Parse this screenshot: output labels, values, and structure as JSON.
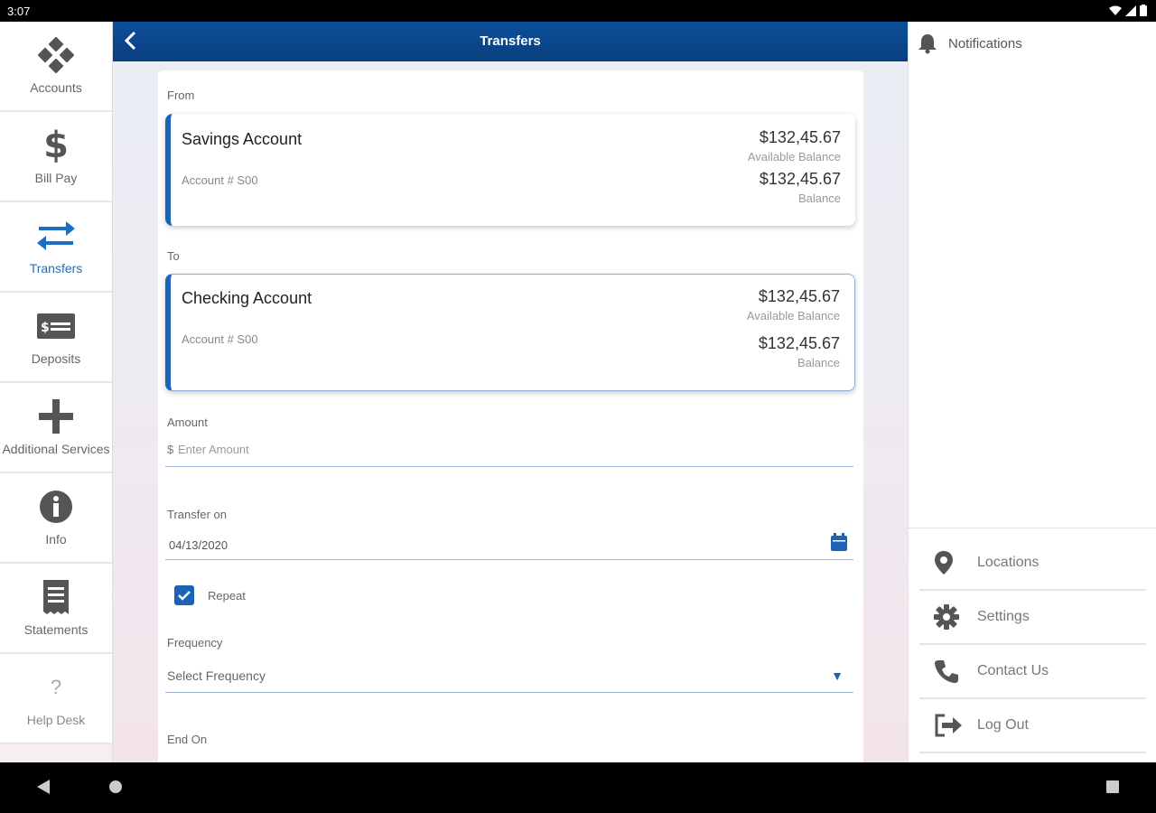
{
  "status_bar": {
    "time": "3:07"
  },
  "left_nav": {
    "items": [
      {
        "label": "Accounts"
      },
      {
        "label": "Bill Pay"
      },
      {
        "label": "Transfers"
      },
      {
        "label": "Deposits"
      },
      {
        "label": "Additional Services"
      },
      {
        "label": "Info"
      },
      {
        "label": "Statements"
      },
      {
        "label": "Help Desk"
      }
    ],
    "active": "Transfers"
  },
  "header": {
    "title": "Transfers"
  },
  "form": {
    "from_label": "From",
    "from_account": {
      "name": "Savings Account",
      "number": "Account # S00",
      "available_balance": "$132,45.67",
      "available_balance_label": "Available Balance",
      "balance": "$132,45.67",
      "balance_label": "Balance"
    },
    "to_label": "To",
    "to_account": {
      "name": "Checking Account",
      "number": "Account # S00",
      "available_balance": "$132,45.67",
      "available_balance_label": "Available Balance",
      "balance": "$132,45.67",
      "balance_label": "Balance"
    },
    "amount_label": "Amount",
    "amount_currency": "$",
    "amount_placeholder": "Enter Amount",
    "transfer_on_label": "Transfer on",
    "transfer_on_value": "04/13/2020",
    "repeat_label": "Repeat",
    "repeat_checked": true,
    "frequency_label": "Frequency",
    "frequency_value": "Select Frequency",
    "end_on_label": "End On"
  },
  "right_panel": {
    "notifications_label": "Notifications",
    "items": [
      {
        "label": "Locations",
        "icon": "location-pin-icon"
      },
      {
        "label": "Settings",
        "icon": "gear-icon"
      },
      {
        "label": "Contact Us",
        "icon": "phone-icon"
      },
      {
        "label": "Log Out",
        "icon": "logout-icon"
      }
    ]
  },
  "colors": {
    "brand_blue": "#0b4f9a",
    "accent": "#1a63b8"
  }
}
